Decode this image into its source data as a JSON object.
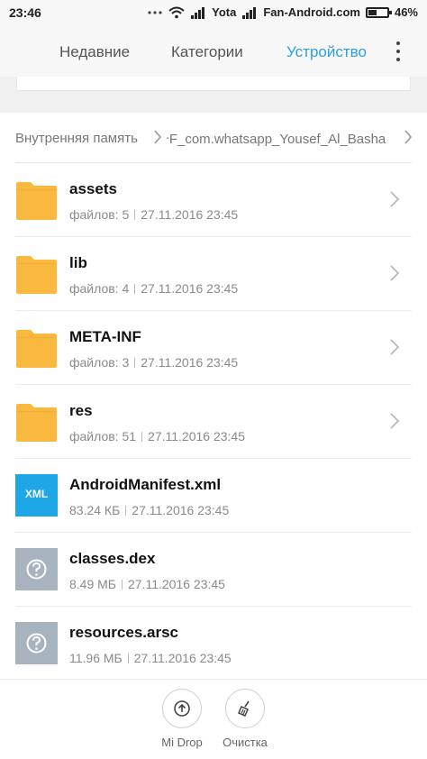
{
  "status_bar": {
    "time": "23:46",
    "carrier": "Yota",
    "carrier2": "Fan-Android.com",
    "battery": "46%",
    "battery_level": 0.46
  },
  "tabs": [
    {
      "label": "Недавние",
      "active": false
    },
    {
      "label": "Категории",
      "active": false
    },
    {
      "label": "Устройство",
      "active": true
    }
  ],
  "breadcrumb": [
    {
      "label": "Внутренняя память"
    },
    {
      "label": "ᐧF_com.whatsapp_Yousef_Al_Basha"
    }
  ],
  "files": [
    {
      "name": "assets",
      "type": "folder",
      "meta": "файлов: 5",
      "date": "27.11.2016 23:45"
    },
    {
      "name": "lib",
      "type": "folder",
      "meta": "файлов: 4",
      "date": "27.11.2016 23:45"
    },
    {
      "name": "META-INF",
      "type": "folder",
      "meta": "файлов: 3",
      "date": "27.11.2016 23:45"
    },
    {
      "name": "res",
      "type": "folder",
      "meta": "файлов: 51",
      "date": "27.11.2016 23:45"
    },
    {
      "name": "AndroidManifest.xml",
      "type": "xml",
      "icon_label": "XML",
      "meta": "83.24 КБ",
      "date": "27.11.2016 23:45"
    },
    {
      "name": "classes.dex",
      "type": "unknown",
      "meta": "8.49 МБ",
      "date": "27.11.2016 23:45"
    },
    {
      "name": "resources.arsc",
      "type": "unknown",
      "meta": "11.96 МБ",
      "date": "27.11.2016 23:45"
    }
  ],
  "bottom_actions": {
    "midrop_label": "Mi Drop",
    "clean_label": "Очистка"
  },
  "colors": {
    "accent": "#2a9fe8",
    "folder": "#f9b93f",
    "xml": "#1ea7e6",
    "unknown": "#a7b4c0"
  },
  "icons": {
    "folder": "folder-icon",
    "xml": "xml-file-icon",
    "unknown": "unknown-file-icon",
    "midrop": "midrop-icon",
    "clean": "broom-icon"
  }
}
